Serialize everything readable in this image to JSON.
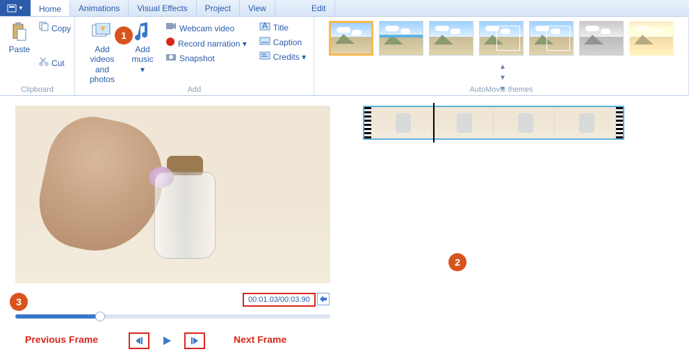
{
  "tabs": [
    "Home",
    "Animations",
    "Visual Effects",
    "Project",
    "View",
    "Edit"
  ],
  "clipboard": {
    "paste": "Paste",
    "copy": "Copy",
    "cut": "Cut",
    "label": "Clipboard"
  },
  "add": {
    "add_videos": "Add videos and photos",
    "add_music": "Add music",
    "webcam": "Webcam video",
    "record": "Record narration",
    "snapshot": "Snapshot",
    "title": "Title",
    "caption": "Caption",
    "credits": "Credits",
    "label": "Add"
  },
  "themes": {
    "label": "AutoMovie themes"
  },
  "time": "00:01.03/00:03.90",
  "annot": {
    "prev": "Previous Frame",
    "next": "Next Frame",
    "n1": "1",
    "n2": "2",
    "n3": "3"
  }
}
